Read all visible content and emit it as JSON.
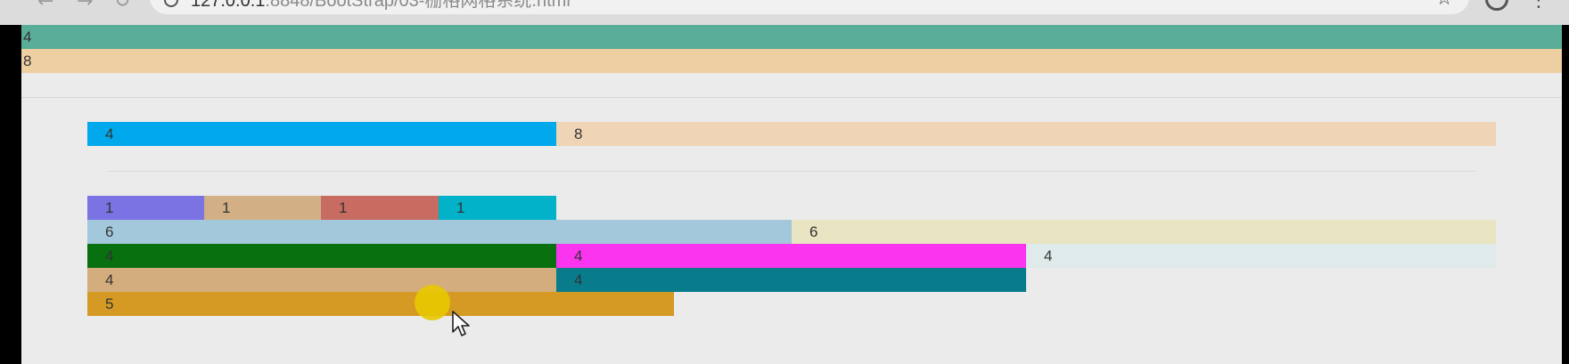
{
  "browser": {
    "url_host": "127.0.0.1",
    "url_path": ":8848/BootStrap/03-栅格网格系统.html",
    "back_icon": "←",
    "forward_icon": "→",
    "reload_icon": "↻",
    "star_icon": "☆",
    "menu_icon": "⋮"
  },
  "fluid_rows": [
    {
      "label": "4",
      "color": "#5aae99"
    },
    {
      "label": "8",
      "color": "#eecfa2"
    }
  ],
  "container_rows": {
    "row1": [
      {
        "label": "4",
        "color": "#01a9ec"
      },
      {
        "label": "8",
        "color": "#efd4b6"
      }
    ],
    "row2": [
      {
        "label": "1",
        "color": "#7b73e3"
      },
      {
        "label": "1",
        "color": "#d2af85"
      },
      {
        "label": "1",
        "color": "#c86b61"
      },
      {
        "label": "1",
        "color": "#02b2c8"
      }
    ],
    "row3": [
      {
        "label": "6",
        "color": "#a3c8db"
      },
      {
        "label": "6",
        "color": "#e9e4c1"
      }
    ],
    "row4": [
      {
        "label": "4",
        "color": "#08700f"
      },
      {
        "label": "4",
        "color": "#fb34ef"
      },
      {
        "label": "4",
        "color": "#dfeaeb"
      }
    ],
    "row5": [
      {
        "label": "4",
        "color": "#d3ad7e"
      },
      {
        "label": "4",
        "color": "#087c8b"
      }
    ],
    "row6": [
      {
        "label": "5",
        "color": "#d49a24"
      }
    ]
  }
}
